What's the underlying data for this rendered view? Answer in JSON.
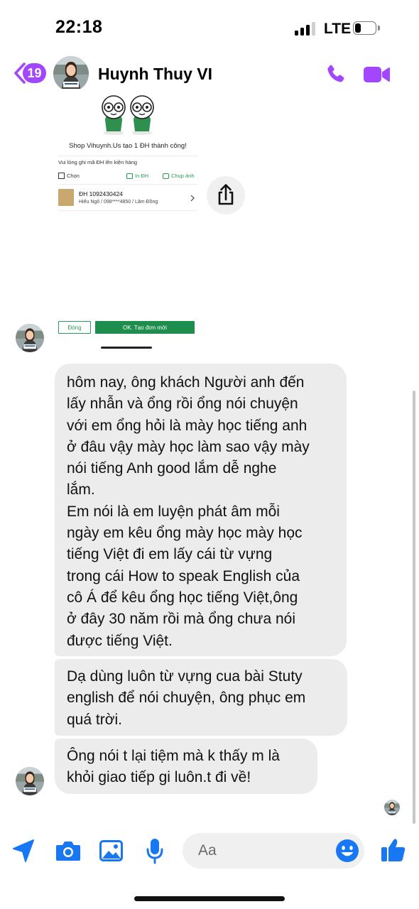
{
  "status_bar": {
    "time": "22:18",
    "network": "LTE",
    "signal_bars_active": 3,
    "battery_level": 0.25
  },
  "header": {
    "back_badge_count": "19",
    "contact_name": "Huynh Thuy VI",
    "accent_color": "#a347ff",
    "icons": [
      "back-chevron-icon",
      "phone-icon",
      "video-camera-icon"
    ]
  },
  "shared_image": {
    "title": "Shop Vihuynh.Us tạo 1 ĐH thành công!",
    "instruction": "Vui lòng ghi mã ĐH lên kiện hàng",
    "select_label": "Chọn",
    "print_label": "In ĐH",
    "photo_label": "Chụp ảnh",
    "order_code": "ĐH 1092430424",
    "order_detail": "Hiếu Ngô / 098****4850 / Lâm Đồng",
    "close_button": "Đóng",
    "create_button": "OK. Tạo đơn mới",
    "brand_green": "#1e8e4f"
  },
  "messages": [
    {
      "text": "hôm nay, ông khách Người anh đến\nlấy nhẫn và ổng rồi ổng nói chuyện\nvới em ổng hỏi là mày học tiếng anh\nở đâu vậy mày học làm sao vậy mày\nnói tiếng Anh good lắm dễ nghe\nlắm.\nEm nói là em luyện phát âm mỗi\nngày em kêu ổng mày học mày học\ntiếng Việt đi em lấy cái từ vựng\ntrong cái How to speak English của\ncô Á để kêu ổng học tiếng Việt,ông\nở đây 30 năm rồi mà ổng chưa nói\nđược tiếng Việt."
    },
    {
      "text": "Dạ dùng luôn từ vựng cua bài Stuty\nenglish để nói chuyện, ông phục em\nquá trời."
    },
    {
      "text": "Ông nói t lại tiệm mà k thấy m là\nkhỏi giao tiếp gi luôn.t đi về!"
    }
  ],
  "composer": {
    "placeholder": "Aa",
    "icons": [
      "location-arrow-icon",
      "camera-icon",
      "gallery-icon",
      "microphone-icon",
      "emoji-icon",
      "thumbs-up-icon"
    ],
    "icon_color": "#1877f2"
  }
}
